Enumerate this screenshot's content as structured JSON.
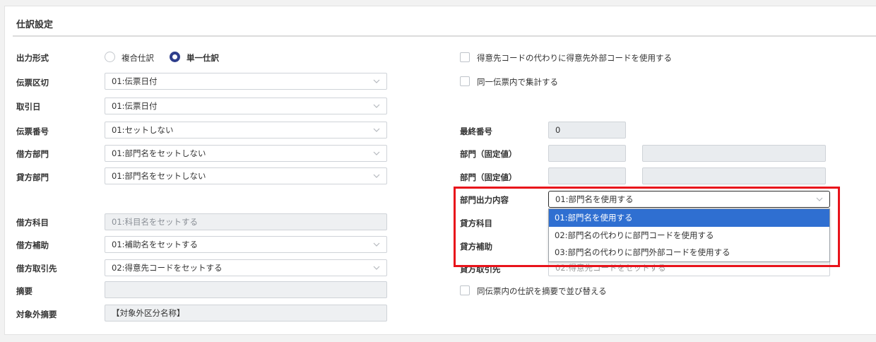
{
  "section": {
    "title": "仕訳設定"
  },
  "left": {
    "output_format": {
      "label": "出力形式",
      "options": [
        "複合仕訳",
        "単一仕訳"
      ],
      "selected_index": 1
    },
    "slip_break": {
      "label": "伝票区切",
      "value": "01:伝票日付"
    },
    "transaction_date": {
      "label": "取引日",
      "value": "01:伝票日付"
    },
    "slip_number": {
      "label": "伝票番号",
      "value": "01:セットしない"
    },
    "debit_dept": {
      "label": "借方部門",
      "value": "01:部門名をセットしない"
    },
    "credit_dept": {
      "label": "貸方部門",
      "value": "01:部門名をセットしない"
    },
    "debit_account": {
      "label": "借方科目",
      "value": "01:科目名をセットする"
    },
    "debit_sub": {
      "label": "借方補助",
      "value": "01:補助名をセットする"
    },
    "debit_partner": {
      "label": "借方取引先",
      "value": "02:得意先コードをセットする"
    },
    "summary": {
      "label": "摘要",
      "value": ""
    },
    "excluded_summary": {
      "label": "対象外摘要",
      "value": "【対象外区分名称】"
    }
  },
  "right": {
    "checkbox_external_code": {
      "label": "得意先コードの代わりに得意先外部コードを使用する",
      "checked": false
    },
    "checkbox_aggregate": {
      "label": "同一伝票内で集計する",
      "checked": false
    },
    "last_number": {
      "label": "最終番号",
      "value": "0"
    },
    "dept_fixed_1": {
      "label": "部門（固定値）",
      "code": "",
      "name": ""
    },
    "dept_fixed_2": {
      "label": "部門（固定値）",
      "code": "",
      "name": ""
    },
    "dept_output": {
      "label": "部門出力内容",
      "value": "01:部門名を使用する",
      "options": [
        "01:部門名を使用する",
        "02:部門名の代わりに部門コードを使用する",
        "03:部門名の代わりに部門外部コードを使用する"
      ],
      "selected_index": 0
    },
    "credit_account": {
      "label": "貸方科目"
    },
    "credit_sub": {
      "label": "貸方補助"
    },
    "credit_partner": {
      "label": "貸方取引先",
      "value": "02:得意先コードをセットする"
    },
    "checkbox_sort": {
      "label": "同伝票内の仕訳を摘要で並び替える",
      "checked": false
    }
  },
  "colors": {
    "highlight": "#e8131b",
    "dropdown_selected": "#2f6fd1",
    "radio_checked": "#2e3e8c"
  }
}
